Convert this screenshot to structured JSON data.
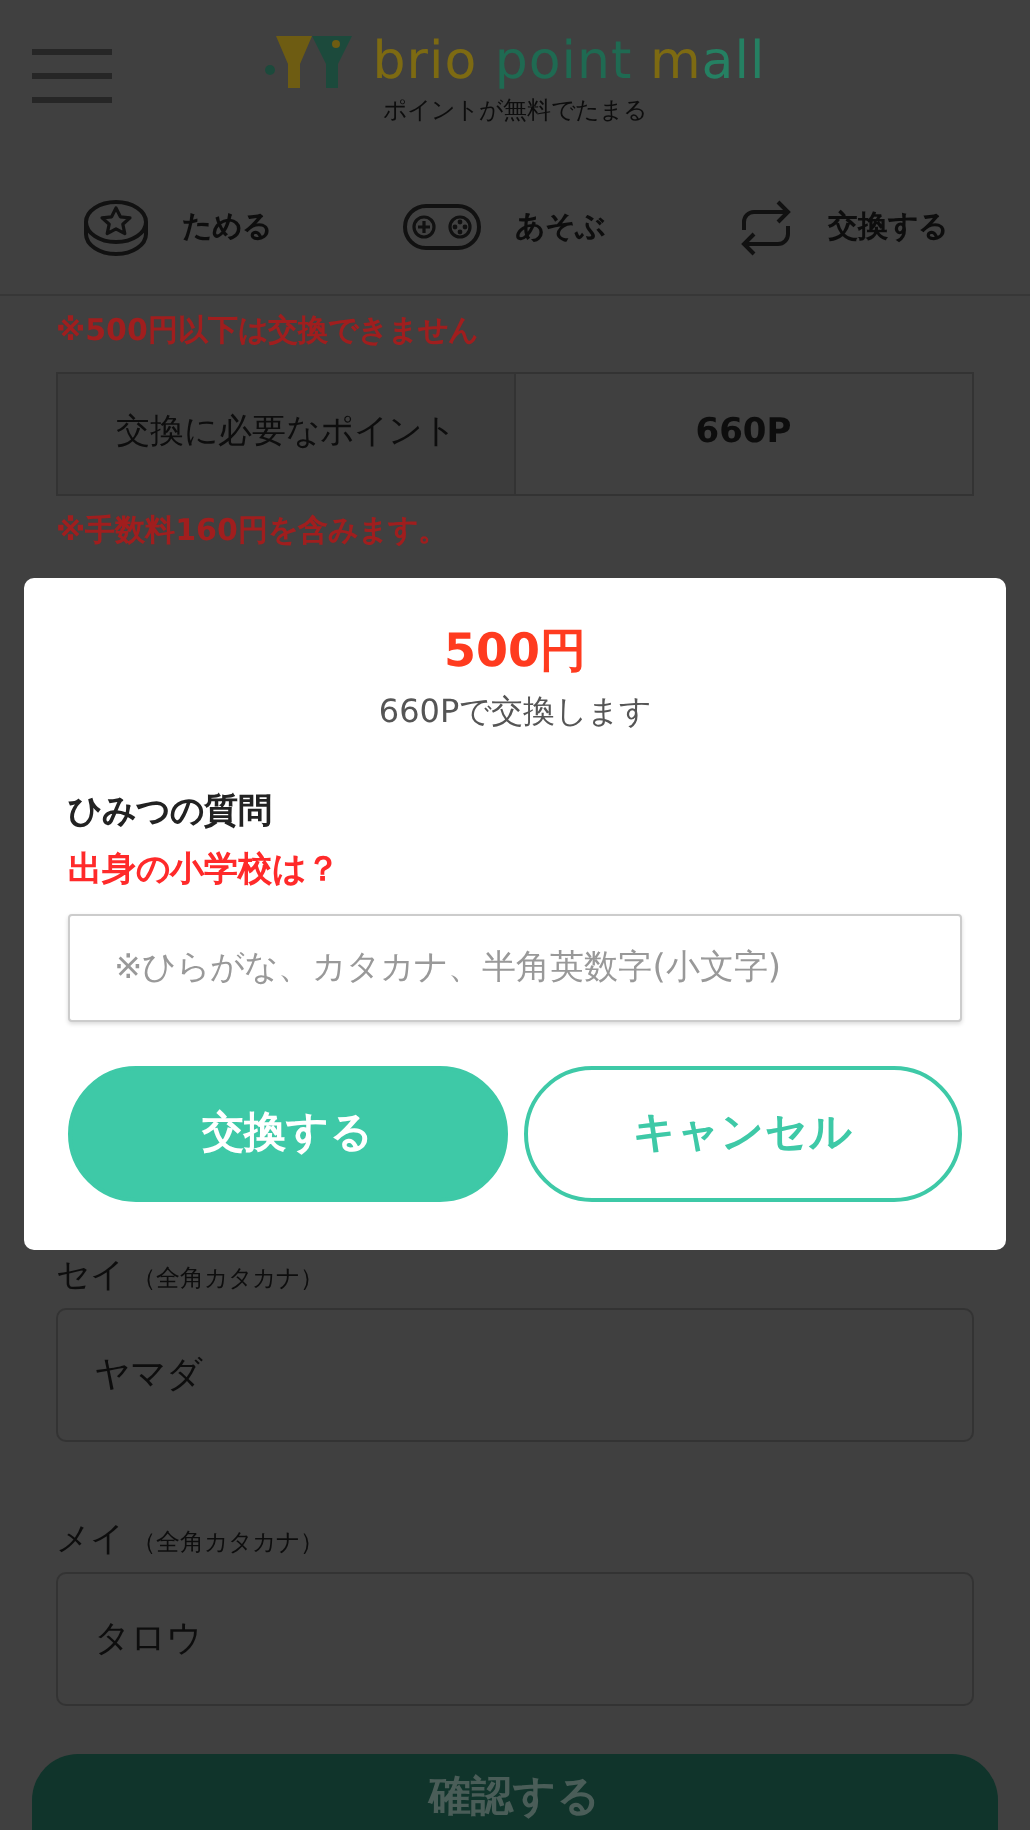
{
  "header": {
    "logo_parts": [
      {
        "text": "brio ",
        "color": "#7d6a12"
      },
      {
        "text": "point ",
        "color": "#1f6a52"
      },
      {
        "text": "m",
        "color": "#7d6a12"
      },
      {
        "text": "all",
        "color": "#258062"
      }
    ],
    "tagline": "ポイントが無料でたまる"
  },
  "nav": [
    {
      "label": "ためる",
      "kind": "coin"
    },
    {
      "label": "あそぶ",
      "kind": "gamepad"
    },
    {
      "label": "交換する",
      "kind": "swap"
    }
  ],
  "notice_top": "※500円以下は交換できません",
  "points_table": {
    "label": "交換に必要なポイント",
    "value": "660P"
  },
  "notice_fee": "※手数料160円を含みます。",
  "form_fields": [
    {
      "label": "セイ",
      "hint": "（全角カタカナ）",
      "value": "ヤマダ"
    },
    {
      "label": "メイ",
      "hint": "（全角カタカナ）",
      "value": "タロウ"
    }
  ],
  "confirm_button": "確認する",
  "modal": {
    "amount": "500円",
    "subtitle": "660Pで交換します",
    "question_title": "ひみつの質問",
    "question": "出身の小学校は？",
    "answer": {
      "placeholder": "※ひらがな、カタカナ、半角英数字(小文字)"
    },
    "buttons": [
      {
        "label": "交換する",
        "kind": "primary"
      },
      {
        "label": "キャンセル",
        "kind": "outline"
      }
    ]
  }
}
